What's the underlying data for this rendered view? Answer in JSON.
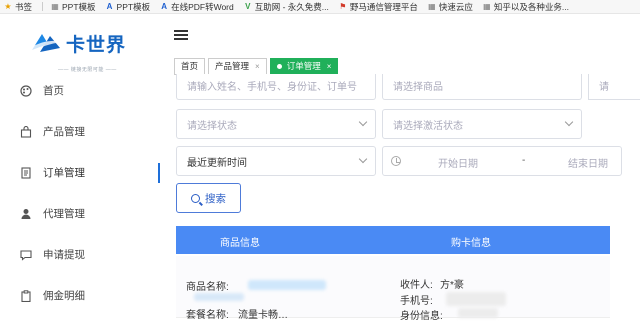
{
  "bookmarks": [
    {
      "icon": "star-icon",
      "label": "书签"
    },
    {
      "icon": "grid-icon",
      "label": "PPT模板"
    },
    {
      "icon": "a-logo-icon",
      "label": "PPT模板"
    },
    {
      "icon": "a-logo-icon",
      "label": "在线PDF转Word"
    },
    {
      "icon": "v-logo-icon",
      "label": "互助网 - 永久免费..."
    },
    {
      "icon": "flag-icon",
      "label": "野马通信管理平台"
    },
    {
      "icon": "grid-icon",
      "label": "快速云应"
    },
    {
      "icon": "grid-icon",
      "label": "知乎以及各种业务..."
    }
  ],
  "brand": {
    "name": "卡世界",
    "tagline": "—— 链接无限可能 ——",
    "color": "#1565c0"
  },
  "sidebar": {
    "items": [
      {
        "label": "首页",
        "icon": "palette-icon"
      },
      {
        "label": "产品管理",
        "icon": "bag-icon"
      },
      {
        "label": "订单管理",
        "icon": "document-icon",
        "active": true
      },
      {
        "label": "代理管理",
        "icon": "person-icon"
      },
      {
        "label": "申请提现",
        "icon": "chat-icon"
      },
      {
        "label": "佣金明细",
        "icon": "clipboard-icon"
      }
    ]
  },
  "tabs": [
    {
      "label": "首页"
    },
    {
      "label": "产品管理",
      "close": "×"
    },
    {
      "label": "订单管理",
      "close": "×",
      "active": true
    }
  ],
  "filters": {
    "row1_a_placeholder": "请输入姓名、手机号、身份证、订单号",
    "row1_b_placeholder": "请选择商品",
    "row1_c_placeholder": "请",
    "status_placeholder": "请选择状态",
    "activation_placeholder": "请选择激活状态",
    "sort_value": "最近更新时间",
    "date_start_placeholder": "开始日期",
    "date_separator": "-",
    "date_end_placeholder": "结束日期"
  },
  "search_button": {
    "label": "搜索"
  },
  "table": {
    "headers": [
      "商品信息",
      "购卡信息"
    ],
    "header_color": "#4a8af4",
    "row": {
      "product_name_label": "商品名称:",
      "package_name_label": "套餐名称:",
      "package_name_value": "流量卡畅…",
      "receiver_label": "收件人:",
      "receiver_value": "方*豪",
      "phone_label": "手机号:",
      "idinfo_label": "身份信息:"
    }
  }
}
